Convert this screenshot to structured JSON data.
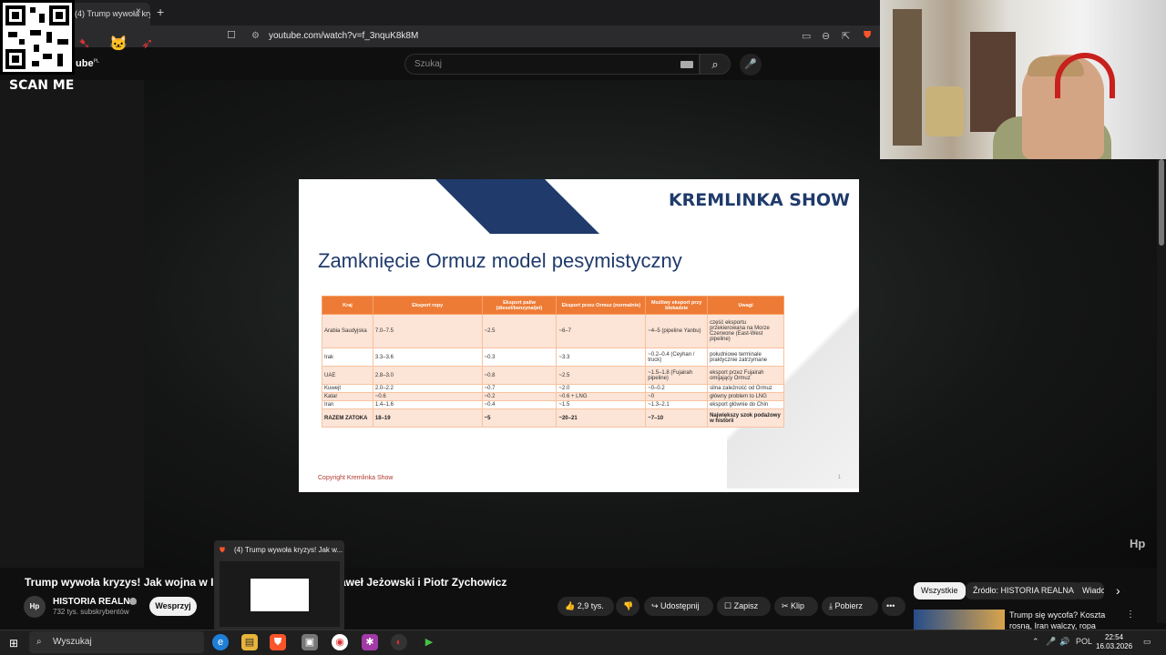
{
  "browser": {
    "tab_title": "(4) Trump wywoła kryzys! Jak",
    "tab_close": "×",
    "new_tab": "+",
    "url": "youtube.com/watch?v=f_3nquK8k8M"
  },
  "youtube": {
    "logo_text": "ube",
    "logo_superscript": "PL",
    "search_placeholder": "Szukaj"
  },
  "overlay": {
    "scan_me": "SCAN ME"
  },
  "slide": {
    "brand": "KREMLINKA SHOW",
    "title": "Zamknięcie Ormuz model pesymistyczny",
    "copyright": "Copyright Kremlinka Show",
    "page_number": "1",
    "table": {
      "headers": [
        "Kraj",
        "Eksport ropy",
        "Eksport paliw (diesel/benzyna/jet)",
        "Eksport przez Ormuz (normalnie)",
        "Możliwy eksport przy blokadzie",
        "Uwagi"
      ],
      "rows": [
        [
          "Arabia Saudyjska",
          "7.0–7.5",
          "~2.5",
          "~6–7",
          "~4–5 (pipeline Yanbu)",
          "część eksportu przekierowana na Morze Czerwone (East-West pipeline)"
        ],
        [
          "Irak",
          "3.3–3.6",
          "~0.3",
          "~3.3",
          "~0.2–0.4 (Ceyhan / truck)",
          "południowe terminale praktycznie zatrzymane"
        ],
        [
          "UAE",
          "2.8–3.0",
          "~0.8",
          "~2.5",
          "~1.5–1.8 (Fujairah pipeline)",
          "eksport przez Fujairah omijający Ormuz"
        ],
        [
          "Kuwejt",
          "2.0–2.2",
          "~0.7",
          "~2.0",
          "~0–0.2",
          "silna zależność od Ormuz"
        ],
        [
          "Katar",
          "~0.6",
          "~0.2",
          "~0.6 + LNG",
          "~0",
          "główny problem to LNG"
        ],
        [
          "Iran",
          "1.4–1.6",
          "~0.4",
          "~1.5",
          "~1.3–2.1",
          "eksport głównie do Chin"
        ]
      ],
      "total": [
        "RAZEM ZATOKA",
        "18–19",
        "~5",
        "~20–21",
        "~7–10",
        "Największy szok podażowy w historii"
      ]
    }
  },
  "video_info": {
    "title_left": "Trump wywoła kryzys! Jak wojna w Iran",
    "title_right": "aweł Jeżowski i Piotr Zychowicz",
    "channel_avatar": "Hp",
    "channel_name": "HISTORIA REALNA",
    "subscribers": "732 tys. subskrybentów",
    "support_button": "Wesprzyj",
    "likes": "2,9 tys.",
    "share": "Udostępnij",
    "save": "Zapisz",
    "clip": "Klip",
    "download": "Pobierz",
    "more": "•••"
  },
  "sidebar": {
    "chips": [
      "Wszystkie",
      "Źródło: HISTORIA REALNA",
      "Wiado"
    ],
    "chips_next": "›",
    "rec_title": "Trump się wycofa? Koszta rosną, Iran walczy, ropa drożej..."
  },
  "preview": {
    "title": "(4) Trump wywoła kryzys! Jak w..."
  },
  "watermark": "Hp",
  "taskbar": {
    "search": "Wyszukaj",
    "lang": "POL",
    "time": "22:54",
    "date": "16.03.2026"
  },
  "colors": {
    "slide_navy": "#1f3a6b",
    "table_header": "#ee7b35",
    "table_band": "#fce4d6",
    "copyright": "#b03a2e"
  }
}
